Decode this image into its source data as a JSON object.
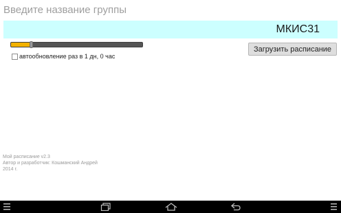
{
  "header": {
    "title": "Введите название группы"
  },
  "group_input": {
    "value": "МКИС31"
  },
  "update_slider": {
    "level_fraction": 0.15
  },
  "auto_update": {
    "label": "автообновление раз в 1 дн, 0 час",
    "checked": false
  },
  "load_button": {
    "label": "Загрузить расписание"
  },
  "footer": {
    "line1": "Мой расписание v2.3",
    "line2": "Автор и разработчик: Кошманский Андрей",
    "line3": "2014 г."
  },
  "colors": {
    "input_background": "#ccffff",
    "slider_fill": "#f2b200",
    "navbar": "#000000"
  },
  "navbar": {
    "icons": [
      "menu-icon",
      "recent-apps-icon",
      "home-icon",
      "back-icon",
      "overflow-menu-icon"
    ]
  }
}
